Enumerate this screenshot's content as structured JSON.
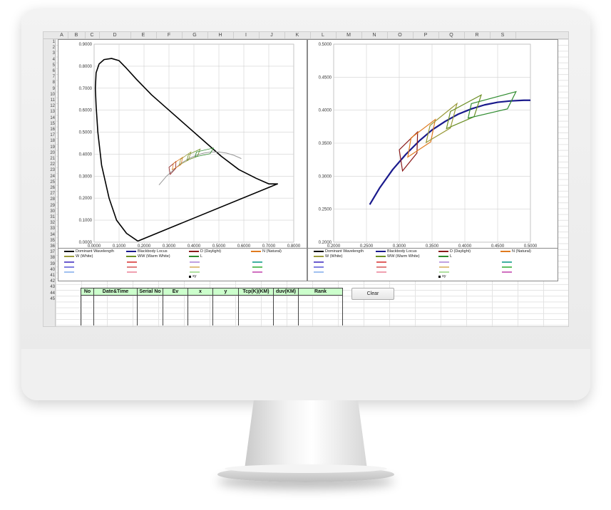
{
  "spreadsheet": {
    "columns": [
      "A",
      "B",
      "C",
      "D",
      "E",
      "F",
      "G",
      "H",
      "I",
      "J",
      "K",
      "L",
      "M",
      "N",
      "O",
      "P",
      "Q",
      "R",
      "S"
    ],
    "rows": [
      "1",
      "2",
      "3",
      "4",
      "5",
      "6",
      "7",
      "8",
      "9",
      "10",
      "11",
      "12",
      "13",
      "14",
      "15",
      "16",
      "17",
      "18",
      "19",
      "20",
      "21",
      "22",
      "23",
      "24",
      "25",
      "26",
      "27",
      "28",
      "29",
      "30",
      "31",
      "32",
      "33",
      "34",
      "35",
      "36",
      "37",
      "38",
      "39",
      "40",
      "41",
      "42",
      "43",
      "44",
      "45"
    ]
  },
  "legend_left": {
    "items": [
      "Dominant Wavelength",
      "Blackbody Locus",
      "D (Daylight)",
      "N (Natural)",
      "W (White)",
      "WW (Warm White)",
      "L",
      "xy"
    ]
  },
  "legend_right": {
    "items": [
      "Dominant Wavelength",
      "Blackbody Locus",
      "D (Daylight)",
      "N (Natural)",
      "W (White)",
      "WW (Warm White)",
      "L",
      "xy"
    ]
  },
  "table": {
    "headers": [
      "No",
      "Date&Time",
      "Serial No",
      "Ev",
      "x",
      "y",
      "Tcp(K)(KM)",
      "duv(KM)",
      "Rank"
    ]
  },
  "clear_button": "Clear",
  "colors": {
    "locus": "#000000",
    "blackbody_right": "#1a1a8c",
    "header_green": "#ccffcc"
  },
  "chart_data": [
    {
      "type": "line",
      "title": "",
      "xlabel": "",
      "ylabel": "",
      "xlim": [
        0,
        0.8
      ],
      "ylim": [
        0,
        0.9
      ],
      "x_ticks": [
        "0.0000",
        "0.1000",
        "0.2000",
        "0.3000",
        "0.4000",
        "0.5000",
        "0.6000",
        "0.7000",
        "0.8000"
      ],
      "y_ticks": [
        "0.0000",
        "0.1000",
        "0.2000",
        "0.3000",
        "0.4000",
        "0.5000",
        "0.6000",
        "0.7000",
        "0.8000",
        "0.9000"
      ],
      "series": [
        {
          "name": "Dominant Wavelength",
          "x": [
            0.175,
            0.13,
            0.09,
            0.06,
            0.03,
            0.015,
            0.008,
            0.005,
            0.008,
            0.02,
            0.04,
            0.07,
            0.1,
            0.13,
            0.17,
            0.23,
            0.3,
            0.37,
            0.44,
            0.51,
            0.58,
            0.65,
            0.7,
            0.735,
            0.175
          ],
          "y": [
            0.005,
            0.04,
            0.1,
            0.2,
            0.35,
            0.5,
            0.62,
            0.7,
            0.77,
            0.81,
            0.83,
            0.835,
            0.825,
            0.79,
            0.74,
            0.67,
            0.6,
            0.53,
            0.46,
            0.39,
            0.33,
            0.29,
            0.265,
            0.265,
            0.005
          ]
        },
        {
          "name": "Blackbody Locus",
          "x": [
            0.26,
            0.29,
            0.32,
            0.35,
            0.38,
            0.41,
            0.44,
            0.47,
            0.5,
            0.53,
            0.56,
            0.59
          ],
          "y": [
            0.26,
            0.3,
            0.33,
            0.36,
            0.38,
            0.395,
            0.405,
            0.41,
            0.41,
            0.405,
            0.395,
            0.38
          ]
        }
      ]
    },
    {
      "type": "line",
      "title": "",
      "xlabel": "",
      "ylabel": "",
      "xlim": [
        0.2,
        0.5
      ],
      "ylim": [
        0.2,
        0.5
      ],
      "x_ticks": [
        "0.2000",
        "0.2500",
        "0.3000",
        "0.3500",
        "0.4000",
        "0.4500",
        "0.5000"
      ],
      "y_ticks": [
        "0.2000",
        "0.2500",
        "0.3000",
        "0.3500",
        "0.4000",
        "0.4500",
        "0.5000"
      ],
      "series": [
        {
          "name": "Blackbody Locus",
          "x": [
            0.255,
            0.27,
            0.29,
            0.31,
            0.33,
            0.35,
            0.37,
            0.39,
            0.41,
            0.43,
            0.45,
            0.47,
            0.49,
            0.5
          ],
          "y": [
            0.257,
            0.282,
            0.31,
            0.333,
            0.353,
            0.37,
            0.383,
            0.394,
            0.402,
            0.408,
            0.412,
            0.414,
            0.415,
            0.415
          ]
        }
      ],
      "quadrilaterals": [
        {
          "color": "#8b1a1a",
          "pts": [
            [
              0.3,
              0.34
            ],
            [
              0.328,
              0.367
            ],
            [
              0.327,
              0.335
            ],
            [
              0.305,
              0.308
            ]
          ]
        },
        {
          "color": "#e07b20",
          "pts": [
            [
              0.318,
              0.358
            ],
            [
              0.355,
              0.386
            ],
            [
              0.348,
              0.352
            ],
            [
              0.313,
              0.329
            ]
          ]
        },
        {
          "color": "#9a9a3a",
          "pts": [
            [
              0.347,
              0.377
            ],
            [
              0.388,
              0.41
            ],
            [
              0.378,
              0.373
            ],
            [
              0.341,
              0.351
            ]
          ]
        },
        {
          "color": "#6b8e23",
          "pts": [
            [
              0.378,
              0.398
            ],
            [
              0.425,
              0.423
            ],
            [
              0.414,
              0.39
            ],
            [
              0.372,
              0.372
            ]
          ]
        },
        {
          "color": "#2e8b2e",
          "pts": [
            [
              0.41,
              0.41
            ],
            [
              0.478,
              0.428
            ],
            [
              0.465,
              0.402
            ],
            [
              0.405,
              0.388
            ]
          ]
        }
      ]
    }
  ]
}
